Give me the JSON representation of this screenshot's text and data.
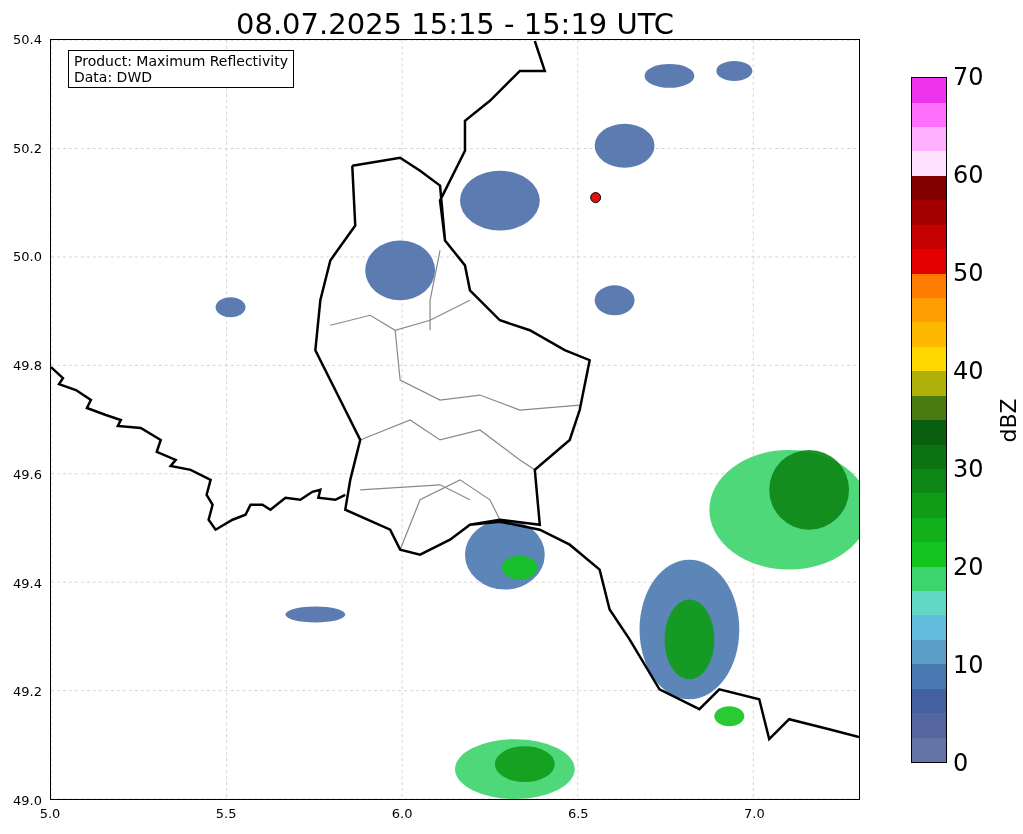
{
  "title": "08.07.2025 15:15 - 15:19 UTC",
  "legend": [
    "Product: Maximum Reflectivity",
    "Data: DWD"
  ],
  "y_ticks": [
    "50.4",
    "50.2",
    "50.0",
    "49.8",
    "49.6",
    "49.4",
    "49.2",
    "49.0"
  ],
  "x_ticks": [
    "5.0",
    "5.5",
    "6.0",
    "6.5",
    "7.0"
  ],
  "colorbar": {
    "label": "dBZ",
    "ticks": [
      "70",
      "60",
      "50",
      "40",
      "30",
      "20",
      "10",
      "0"
    ],
    "segments": [
      {
        "color": "#6475a5"
      },
      {
        "color": "#5465a0"
      },
      {
        "color": "#4560a0"
      },
      {
        "color": "#4a78b0"
      },
      {
        "color": "#5a9ec8"
      },
      {
        "color": "#64bcdc"
      },
      {
        "color": "#62d8c4"
      },
      {
        "color": "#3cd46c"
      },
      {
        "color": "#12c41e"
      },
      {
        "color": "#10b01a"
      },
      {
        "color": "#0e9c16"
      },
      {
        "color": "#0c8614"
      },
      {
        "color": "#0c7212"
      },
      {
        "color": "#0a5e10"
      },
      {
        "color": "#4a7a10"
      },
      {
        "color": "#b0b00a"
      },
      {
        "color": "#ffd800"
      },
      {
        "color": "#ffb800"
      },
      {
        "color": "#ff9c00"
      },
      {
        "color": "#ff7c00"
      },
      {
        "color": "#e40000"
      },
      {
        "color": "#c40000"
      },
      {
        "color": "#a40000"
      },
      {
        "color": "#800000"
      },
      {
        "color": "#ffe0ff"
      },
      {
        "color": "#ffb0ff"
      },
      {
        "color": "#ff70ff"
      },
      {
        "color": "#ee33ee"
      }
    ]
  }
}
